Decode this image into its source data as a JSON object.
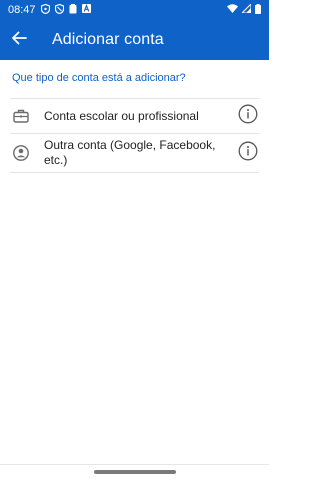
{
  "status_bar": {
    "time": "08:47",
    "left_icons": [
      "shield-icon",
      "shield-check-icon",
      "clipboard-icon",
      "a-box-icon"
    ],
    "right_icons": [
      "wifi-icon",
      "signal-icon",
      "battery-icon"
    ]
  },
  "app_bar": {
    "back_icon": "arrow-left-icon",
    "title": "Adicionar conta"
  },
  "content": {
    "prompt": "Que tipo de conta está a adicionar?",
    "options": [
      {
        "icon": "briefcase-icon",
        "label": "Conta escolar ou profissional",
        "info_icon": "info-icon"
      },
      {
        "icon": "account-circle-icon",
        "label": "Outra conta (Google, Facebook, etc.)",
        "info_icon": "info-icon"
      }
    ]
  },
  "colors": {
    "brand": "#0f62c8",
    "text": "#222222",
    "divider": "#e3e3e3"
  }
}
